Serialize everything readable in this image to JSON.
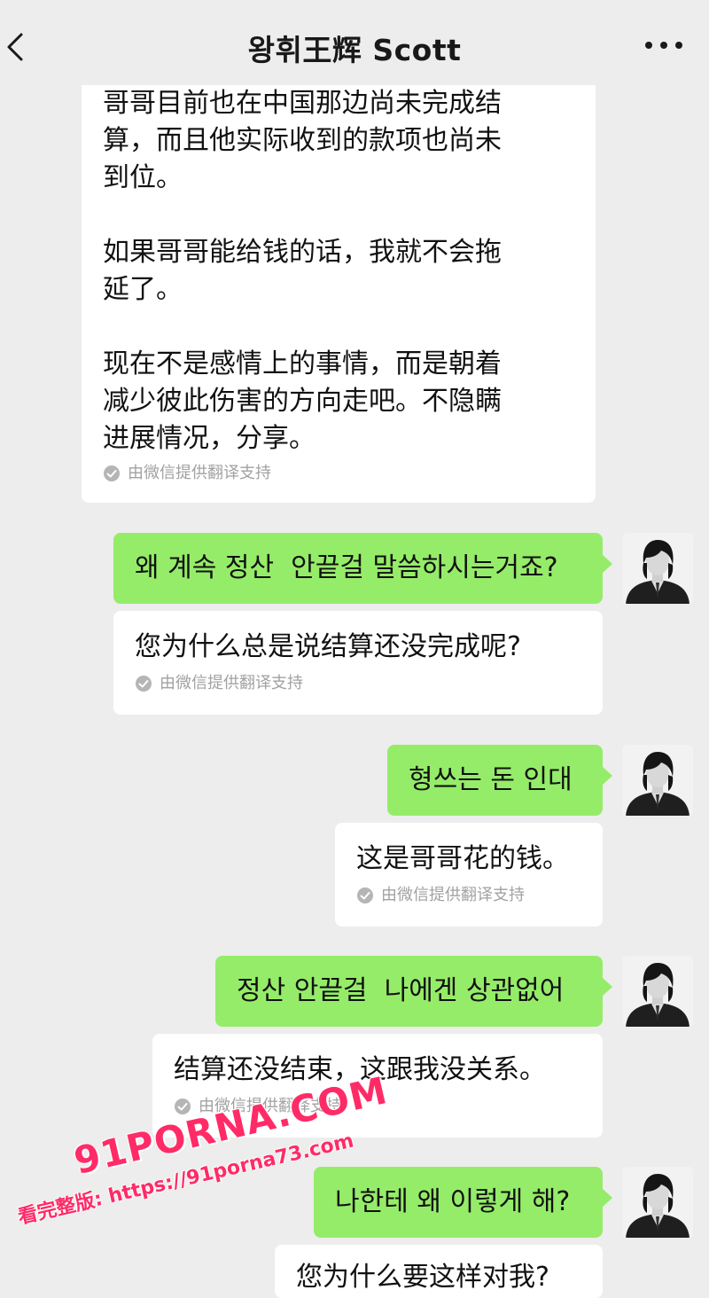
{
  "header": {
    "title": "왕휘王辉 Scott",
    "back_icon": "chevron-left-icon",
    "more_icon": "more-dots-icon"
  },
  "messages": [
    {
      "side": "left",
      "text": "哥哥目前也在中国那边尚未完成结\n算，而且他实际收到的款项也尚未\n到位。\n\n如果哥哥能给钱的话，我就不会拖\n延了。\n\n现在不是感情上的事情，而是朝着\n减少彼此伤害的方向走吧。不隐瞒\n进展情况，分享。",
      "translation_note": "由微信提供翻译支持"
    },
    {
      "side": "right",
      "text": "왜 계속 정산  안끝걸 말씀하시는거죠?",
      "translation": "您为什么总是说结算还没完成呢?",
      "translation_note": "由微信提供翻译支持"
    },
    {
      "side": "right",
      "text": "형쓰는 돈 인대",
      "translation": "这是哥哥花的钱。",
      "translation_note": "由微信提供翻译支持"
    },
    {
      "side": "right",
      "text": "정산 안끝걸  나에겐 상관없어",
      "translation": "结算还没结束，这跟我没关系。",
      "translation_note": "由微信提供翻译支持"
    },
    {
      "side": "right",
      "text": "나한테 왜 이렇게 해?",
      "translation": "您为什么要这样对我?"
    }
  ],
  "watermark": {
    "logo": "91PORNA.COM",
    "url": "看完整版: https://91porna73.com"
  },
  "colors": {
    "background": "#ededed",
    "sent_bubble": "#95ec69",
    "received_bubble": "#ffffff",
    "note_text": "#a2a2a2",
    "watermark": "#ff2b67"
  }
}
